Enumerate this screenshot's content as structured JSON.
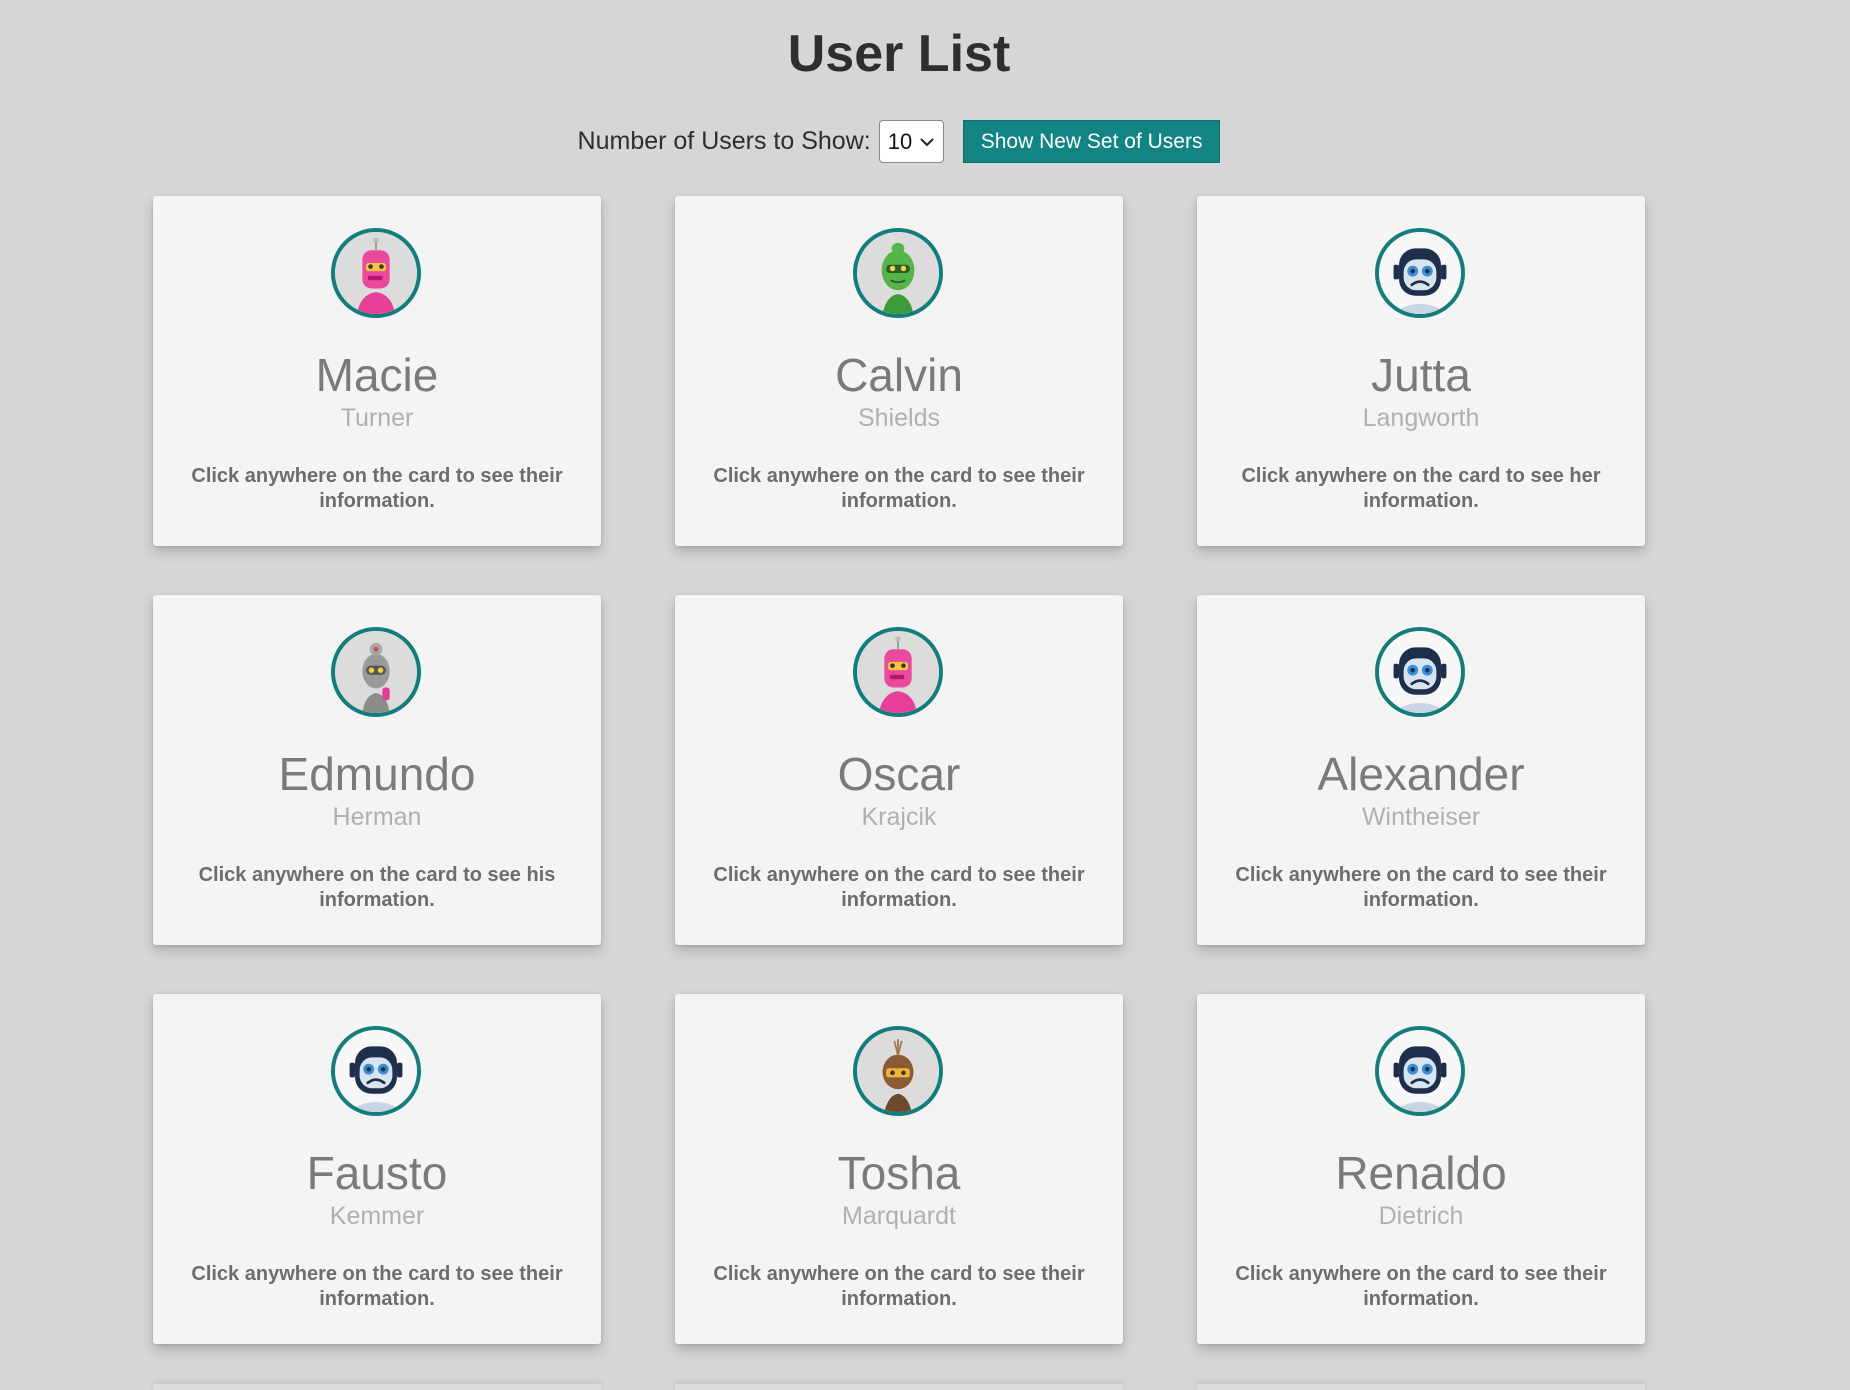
{
  "header": {
    "title": "User List"
  },
  "controls": {
    "label": "Number of Users to Show:",
    "count_selected": "10",
    "button_label": "Show New Set of Users"
  },
  "colors": {
    "accent": "#138484",
    "background": "#d6d6d6",
    "card": "#f4f4f4"
  },
  "users": [
    {
      "first": "Macie",
      "last": "Turner",
      "hint": "Click anywhere on the card to see their information.",
      "avatar": "pink-robot-icon"
    },
    {
      "first": "Calvin",
      "last": "Shields",
      "hint": "Click anywhere on the card to see their information.",
      "avatar": "green-robot-icon"
    },
    {
      "first": "Jutta",
      "last": "Langworth",
      "hint": "Click anywhere on the card to see her information.",
      "avatar": "sad-robot-icon"
    },
    {
      "first": "Edmundo",
      "last": "Herman",
      "hint": "Click anywhere on the card to see his information.",
      "avatar": "gray-robot-icon"
    },
    {
      "first": "Oscar",
      "last": "Krajcik",
      "hint": "Click anywhere on the card to see their information.",
      "avatar": "pink-robot-icon"
    },
    {
      "first": "Alexander",
      "last": "Wintheiser",
      "hint": "Click anywhere on the card to see their information.",
      "avatar": "sad-robot-icon"
    },
    {
      "first": "Fausto",
      "last": "Kemmer",
      "hint": "Click anywhere on the card to see their information.",
      "avatar": "sad-robot-icon"
    },
    {
      "first": "Tosha",
      "last": "Marquardt",
      "hint": "Click anywhere on the card to see their information.",
      "avatar": "brown-robot-icon"
    },
    {
      "first": "Renaldo",
      "last": "Dietrich",
      "hint": "Click anywhere on the card to see their information.",
      "avatar": "sad-robot-icon"
    }
  ]
}
